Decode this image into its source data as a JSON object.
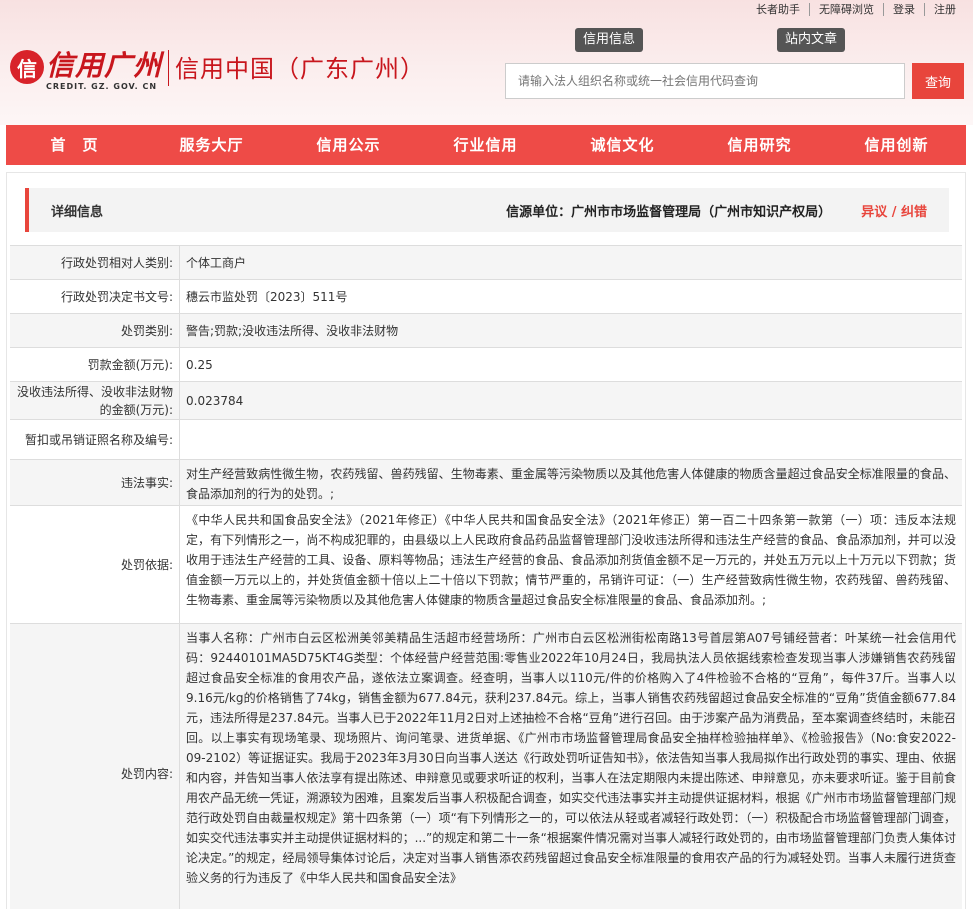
{
  "toplinks": [
    "长者助手",
    "无障碍浏览",
    "登录",
    "注册"
  ],
  "logo": {
    "mark": "信",
    "cn": "信用广州",
    "en": "CREDIT. GZ. GOV. CN",
    "title": "信用中国（广东广州）"
  },
  "badges": {
    "credit_info": "信用信息",
    "site_article": "站内文章"
  },
  "search": {
    "placeholder": "请输入法人组织名称或统一社会信用代码查询",
    "button": "查询"
  },
  "nav": [
    "首　页",
    "服务大厅",
    "信用公示",
    "行业信用",
    "诚信文化",
    "信用研究",
    "信用创新"
  ],
  "detail": {
    "title": "详细信息",
    "source": "信源单位：广州市市场监督管理局（广州市知识产权局）",
    "objection": "异议 / 纠错"
  },
  "rows": [
    {
      "label": "行政处罚相对人类别:",
      "value": "个体工商户"
    },
    {
      "label": "行政处罚决定书文号:",
      "value": "穗云市监处罚〔2023〕511号"
    },
    {
      "label": "处罚类别:",
      "value": "警告;罚款;没收违法所得、没收非法财物"
    },
    {
      "label": "罚款金额(万元):",
      "value": "0.25"
    },
    {
      "label": "没收违法所得、没收非法财物的金额(万元):",
      "value": "0.023784"
    },
    {
      "label": "暂扣或吊销证照名称及编号:",
      "value": ""
    },
    {
      "label": "违法事实:",
      "value": "对生产经营致病性微生物，农药残留、兽药残留、生物毒素、重金属等污染物质以及其他危害人体健康的物质含量超过食品安全标准限量的食品、食品添加剂的行为的处罚。;"
    },
    {
      "label": "处罚依据:",
      "value": "《中华人民共和国食品安全法》（2021年修正）《中华人民共和国食品安全法》（2021年修正）第一百二十四条第一款第（一）项：违反本法规定，有下列情形之一，尚不构成犯罪的，由县级以上人民政府食品药品监督管理部门没收违法所得和违法生产经营的食品、食品添加剂，并可以没收用于违法生产经营的工具、设备、原料等物品；违法生产经营的食品、食品添加剂货值金额不足一万元的，并处五万元以上十万元以下罚款；货值金额一万元以上的，并处货值金额十倍以上二十倍以下罚款；情节严重的，吊销许可证：（一）生产经营致病性微生物，农药残留、兽药残留、生物毒素、重金属等污染物质以及其他危害人体健康的物质含量超过食品安全标准限量的食品、食品添加剂。;"
    },
    {
      "label": "处罚内容:",
      "value": "当事人名称：广州市白云区松洲美邻美精品生活超市经营场所：广州市白云区松洲街松南路13号首层第A07号铺经营者：叶某统一社会信用代码：92440101MA5D75KT4G类型：个体经营户经营范围:零售业2022年10月24日，我局执法人员依据线索检查发现当事人涉嫌销售农药残留超过食品安全标准的食用农产品，遂依法立案调查。经查明，当事人以110元/件的价格购入了4件检验不合格的“豆角”，每件37斤。当事人以9.16元/kg的价格销售了74kg，销售金额为677.84元，获利237.84元。综上，当事人销售农药残留超过食品安全标准的“豆角”货值金额677.84元，违法所得是237.84元。当事人已于2022年11月2日对上述抽检不合格“豆角”进行召回。由于涉案产品为消费品，至本案调查终结时，未能召回。以上事实有现场笔录、现场照片、询问笔录、进货单据、《广州市市场监督管理局食品安全抽样检验抽样单》、《检验报告》（No:食安2022-09-2102）等证据证实。我局于2023年3月30日向当事人送达《行政处罚听证告知书》，依法告知当事人我局拟作出行政处罚的事实、理由、依据和内容，并告知当事人依法享有提出陈述、申辩意见或要求听证的权利，当事人在法定期限内未提出陈述、申辩意见，亦未要求听证。鉴于目前食用农产品无统一凭证，溯源较为困难，且案发后当事人积极配合调查，如实交代违法事实并主动提供证据材料，根据《广州市市场监督管理部门规范行政处罚自由裁量权规定》第十四条第（一）项“有下列情形之一的，可以依法从轻或者减轻行政处罚：（一）积极配合市场监督管理部门调查，如实交代违法事实并主动提供证据材料的；...”的规定和第二十一条“根据案件情况需对当事人减轻行政处罚的，由市场监督管理部门负责人集体讨论决定。”的规定，经局领导集体讨论后，决定对当事人销售添农药残留超过食品安全标准限量的食用农产品的行为减轻处罚。当事人未履行进货查验义务的行为违反了《中华人民共和国食品安全法》"
    }
  ]
}
